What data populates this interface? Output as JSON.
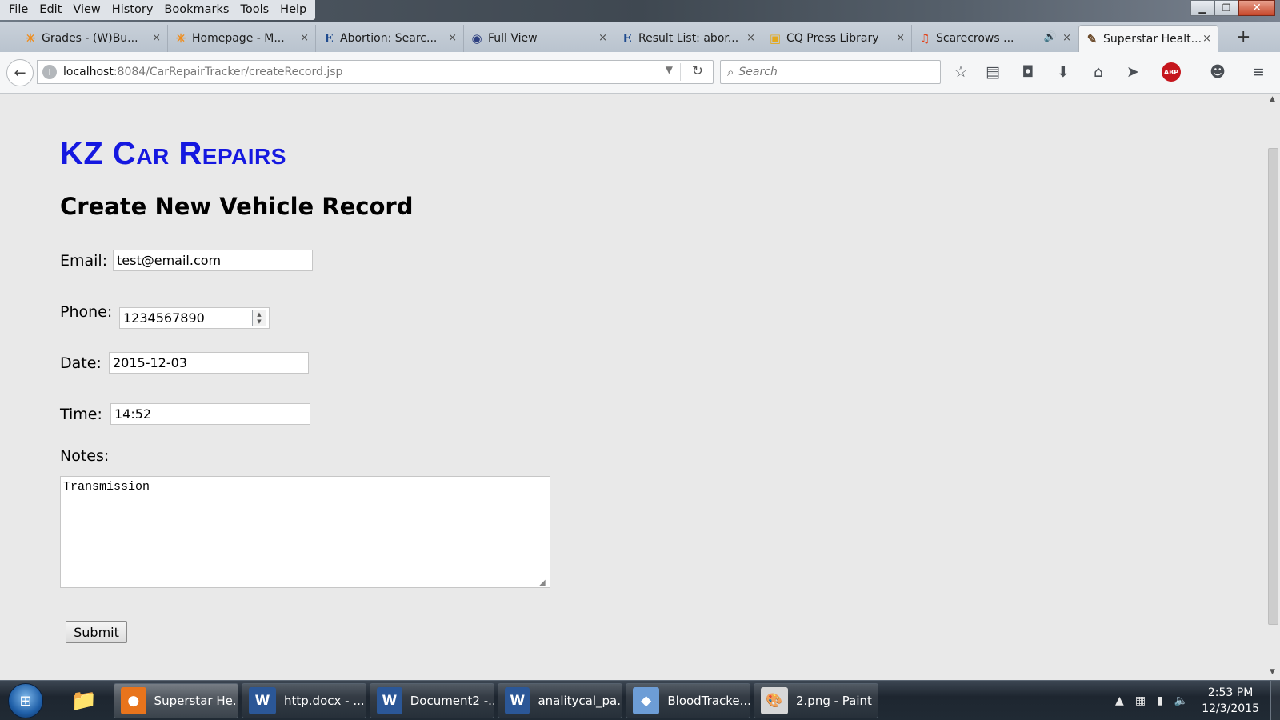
{
  "menubar": {
    "items": [
      {
        "pre": "",
        "acc": "F",
        "post": "ile"
      },
      {
        "pre": "",
        "acc": "E",
        "post": "dit"
      },
      {
        "pre": "",
        "acc": "V",
        "post": "iew"
      },
      {
        "pre": "Hi",
        "acc": "s",
        "post": "tory"
      },
      {
        "pre": "",
        "acc": "B",
        "post": "ookmarks"
      },
      {
        "pre": "",
        "acc": "T",
        "post": "ools"
      },
      {
        "pre": "",
        "acc": "H",
        "post": "elp"
      }
    ]
  },
  "window_controls": {
    "minimize": "▁",
    "restore": "❐",
    "close": "✕"
  },
  "tabs": [
    {
      "label": "Grades - (W)Bu...",
      "icon": "orange-sparkle-icon",
      "glyph": "✳",
      "color": "#f08c1a",
      "close": "×"
    },
    {
      "label": "Homepage - M...",
      "icon": "orange-sparkle-icon",
      "glyph": "✳",
      "color": "#f08c1a",
      "close": "×"
    },
    {
      "label": "Abortion: Searc...",
      "icon": "ebsco-e-icon",
      "glyph": "E",
      "color": "#1f4b8f",
      "close": "×"
    },
    {
      "label": "Full View",
      "icon": "hathi-icon",
      "glyph": "◉",
      "color": "#2d3f80",
      "close": "×"
    },
    {
      "label": "Result List: abor...",
      "icon": "ebsco-e-icon",
      "glyph": "E",
      "color": "#1f4b8f",
      "close": "×"
    },
    {
      "label": "CQ Press Library",
      "icon": "cq-press-icon",
      "glyph": "▣",
      "color": "#e3a81b",
      "close": "×"
    },
    {
      "label": "Scarecrows ...",
      "icon": "headphones-icon",
      "glyph": "♫",
      "color": "#e2431a",
      "close": "×",
      "audio": "🔊"
    },
    {
      "label": "Superstar Healt...",
      "icon": "paint-icon",
      "glyph": "✎",
      "color": "#6b4a2a",
      "close": "×",
      "active": true
    }
  ],
  "new_tab": "+",
  "nav": {
    "back": "←",
    "url_host": "localhost",
    "url_rest": ":8084/CarRepairTracker/createRecord.jsp",
    "url_dropdown": "▼",
    "reload": "↻",
    "search_placeholder": "Search",
    "search_icon": "⌕",
    "toolbar_icons": [
      {
        "name": "bookmark-star-icon",
        "glyph": "☆"
      },
      {
        "name": "reading-list-icon",
        "glyph": "▤"
      },
      {
        "name": "pocket-icon",
        "glyph": "◘"
      },
      {
        "name": "downloads-icon",
        "glyph": "⬇"
      },
      {
        "name": "home-icon",
        "glyph": "⌂"
      },
      {
        "name": "send-icon",
        "glyph": "➤"
      },
      {
        "name": "adblock-icon",
        "glyph": "ABP"
      },
      {
        "name": "chat-icon",
        "glyph": "☻"
      },
      {
        "name": "hamburger-menu-icon",
        "glyph": "≡"
      }
    ]
  },
  "page": {
    "brand": "KZ Car Repairs",
    "heading": "Create New Vehicle Record",
    "email": {
      "label": "Email:",
      "value": "test@email.com"
    },
    "phone": {
      "label": "Phone:",
      "value": "1234567890"
    },
    "date": {
      "label": "Date:",
      "value": "2015-12-03"
    },
    "time": {
      "label": "Time:",
      "value": "14:52"
    },
    "notes": {
      "label": "Notes:",
      "value": "Transmission"
    },
    "submit": "Submit"
  },
  "taskbar": {
    "start": "⊞",
    "explorer_icon": "📁",
    "tasks": [
      {
        "label": "Superstar He...",
        "icon": "firefox-icon",
        "glyph": "●",
        "color": "#e8741c",
        "active": true
      },
      {
        "label": "http.docx - ...",
        "icon": "word-icon",
        "glyph": "W",
        "color": "#2b5797"
      },
      {
        "label": "Document2 -...",
        "icon": "word-icon",
        "glyph": "W",
        "color": "#2b5797"
      },
      {
        "label": "analitycal_pa...",
        "icon": "word-icon",
        "glyph": "W",
        "color": "#2b5797"
      },
      {
        "label": "BloodTracke...",
        "icon": "netbeans-cube-icon",
        "glyph": "◆",
        "color": "#6d9dd6"
      },
      {
        "label": "2.png - Paint",
        "icon": "paint-palette-icon",
        "glyph": "🎨",
        "color": "#d7d7d7"
      }
    ],
    "tray_icons": [
      {
        "name": "tray-expand-icon",
        "glyph": "▲"
      },
      {
        "name": "network-icon",
        "glyph": "▦"
      },
      {
        "name": "power-icon",
        "glyph": "▮"
      },
      {
        "name": "volume-icon",
        "glyph": "🔈"
      }
    ],
    "time": "2:53 PM",
    "date": "12/3/2015"
  }
}
